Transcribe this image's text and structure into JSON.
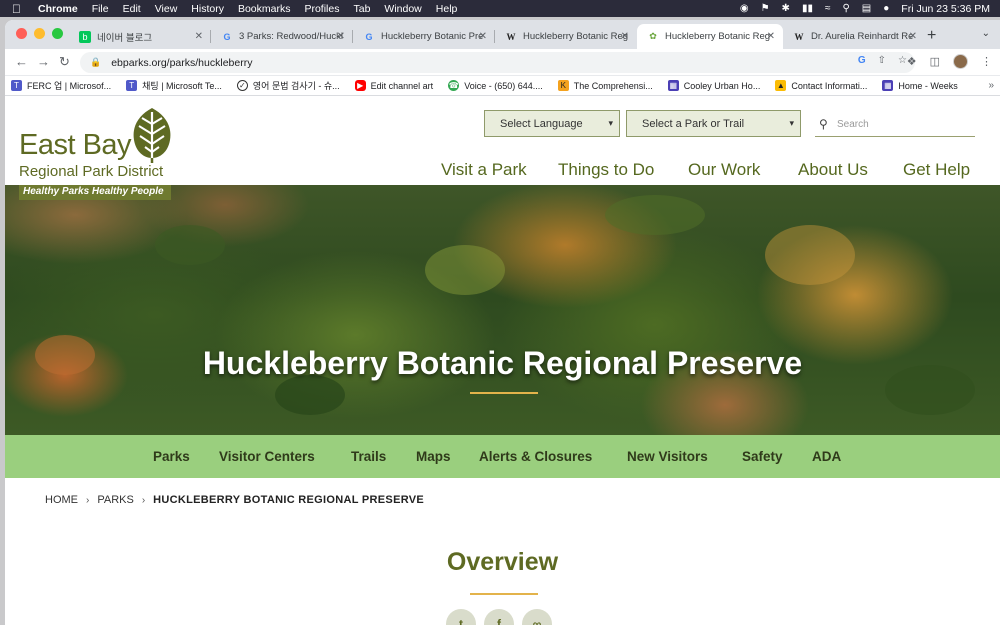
{
  "macos": {
    "menus": [
      "Chrome",
      "File",
      "Edit",
      "View",
      "History",
      "Bookmarks",
      "Profiles",
      "Tab",
      "Window",
      "Help"
    ],
    "clock": "Fri Jun 23  5:36 PM"
  },
  "browser": {
    "tabs": [
      {
        "label": "네이버 블로그",
        "favicon": "naver-blog-icon"
      },
      {
        "label": "3 Parks: Redwood/Huckl",
        "favicon": "google-icon"
      },
      {
        "label": "Huckleberry Botanic Pre",
        "favicon": "google-icon"
      },
      {
        "label": "Huckleberry Botanic Reg",
        "favicon": "wikipedia-icon"
      },
      {
        "label": "Huckleberry Botanic Reg",
        "favicon": "ebparks-leaf-icon"
      },
      {
        "label": "Dr. Aurelia Reinhardt Re",
        "favicon": "wikipedia-icon"
      }
    ],
    "url": "ebparks.org/parks/huckleberry",
    "bookmarks": [
      "FERC 업 | Microsof...",
      "채팅 | Microsoft Te...",
      "영어 문법 검사기 - 슈...",
      "Edit channel art",
      "Voice - (650) 644....",
      "The Comprehensi...",
      "Cooley Urban Ho...",
      "Contact Informati...",
      "Home - Weeks"
    ]
  },
  "site": {
    "logo": {
      "line1": "East Bay",
      "line2": "Regional Park District"
    },
    "tagline": "Healthy Parks Healthy People",
    "language_select": "Select Language",
    "park_select": "Select a Park or Trail",
    "search_placeholder": "Search",
    "main_nav": [
      "Visit a Park",
      "Things to Do",
      "Our Work",
      "About Us",
      "Get Help"
    ],
    "hero_title": "Huckleberry Botanic Regional Preserve",
    "sub_nav": [
      "Parks",
      "Visitor Centers",
      "Trails",
      "Maps",
      "Alerts & Closures",
      "New Visitors",
      "Safety",
      "ADA"
    ],
    "breadcrumb": [
      "HOME",
      "PARKS",
      "HUCKLEBERRY BOTANIC REGIONAL PRESERVE"
    ],
    "section_title": "Overview",
    "share_icons": [
      "twitter-icon",
      "facebook-icon",
      "link-icon"
    ],
    "colors": {
      "brand_green": "#5e6a23",
      "subnav_green": "#9acf7e",
      "accent_gold": "#e3b34b"
    }
  }
}
